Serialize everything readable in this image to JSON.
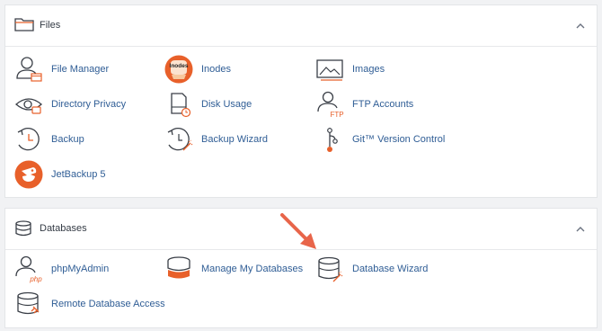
{
  "files": {
    "title": "Files",
    "items": [
      {
        "label": "File Manager",
        "icon": "file-manager-icon"
      },
      {
        "label": "Inodes",
        "icon": "inodes-icon",
        "badge": "Inodes"
      },
      {
        "label": "Images",
        "icon": "images-icon"
      },
      {
        "label": "Directory Privacy",
        "icon": "directory-privacy-icon"
      },
      {
        "label": "Disk Usage",
        "icon": "disk-usage-icon"
      },
      {
        "label": "FTP Accounts",
        "icon": "ftp-accounts-icon",
        "badge": "FTP"
      },
      {
        "label": "Backup",
        "icon": "backup-icon"
      },
      {
        "label": "Backup Wizard",
        "icon": "backup-wizard-icon"
      },
      {
        "label": "Git™ Version Control",
        "icon": "git-icon"
      },
      {
        "label": "JetBackup 5",
        "icon": "jetbackup-icon"
      }
    ]
  },
  "databases": {
    "title": "Databases",
    "items": [
      {
        "label": "phpMyAdmin",
        "icon": "phpmyadmin-icon",
        "badge": "php"
      },
      {
        "label": "Manage My Databases",
        "icon": "manage-databases-icon"
      },
      {
        "label": "Database Wizard",
        "icon": "database-wizard-icon"
      },
      {
        "label": "Remote Database Access",
        "icon": "remote-database-icon"
      }
    ]
  },
  "colors": {
    "accent": "#e8602a",
    "link": "#2f5d95",
    "icon_stroke": "#3a3f47",
    "arrow": "#e8654a"
  }
}
